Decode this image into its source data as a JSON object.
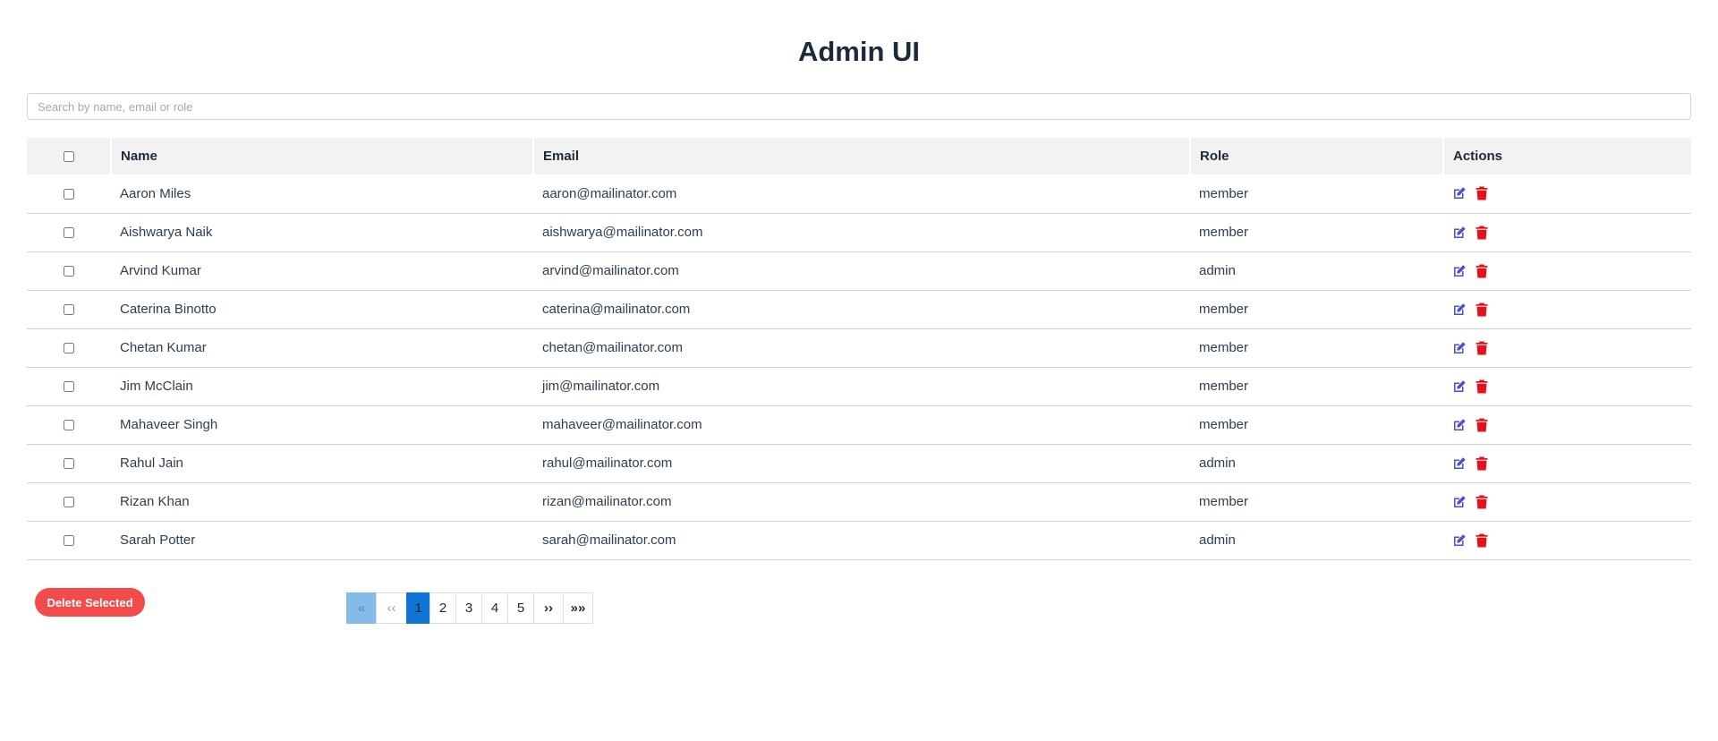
{
  "page": {
    "title": "Admin UI"
  },
  "search": {
    "placeholder": "Search by name, email or role",
    "value": ""
  },
  "table": {
    "headers": {
      "name": "Name",
      "email": "Email",
      "role": "Role",
      "actions": "Actions"
    },
    "rows": [
      {
        "name": "Aaron Miles",
        "email": "aaron@mailinator.com",
        "role": "member"
      },
      {
        "name": "Aishwarya Naik",
        "email": "aishwarya@mailinator.com",
        "role": "member"
      },
      {
        "name": "Arvind Kumar",
        "email": "arvind@mailinator.com",
        "role": "admin"
      },
      {
        "name": "Caterina Binotto",
        "email": "caterina@mailinator.com",
        "role": "member"
      },
      {
        "name": "Chetan Kumar",
        "email": "chetan@mailinator.com",
        "role": "member"
      },
      {
        "name": "Jim McClain",
        "email": "jim@mailinator.com",
        "role": "member"
      },
      {
        "name": "Mahaveer Singh",
        "email": "mahaveer@mailinator.com",
        "role": "member"
      },
      {
        "name": "Rahul Jain",
        "email": "rahul@mailinator.com",
        "role": "admin"
      },
      {
        "name": "Rizan Khan",
        "email": "rizan@mailinator.com",
        "role": "member"
      },
      {
        "name": "Sarah Potter",
        "email": "sarah@mailinator.com",
        "role": "admin"
      }
    ],
    "row_icons": {
      "edit": "edit-icon",
      "delete": "trash-icon"
    }
  },
  "footer": {
    "delete_selected_label": "Delete Selected"
  },
  "pagination": {
    "first_label": "«",
    "prev_label": "‹‹",
    "pages": [
      "1",
      "2",
      "3",
      "4",
      "5"
    ],
    "current_page": "1",
    "next_label": "››",
    "last_label": "»»"
  },
  "colors": {
    "edit_icon": "#4a4fd6",
    "delete_icon": "#e8101a",
    "delete_button": "#f24b4b",
    "active_page": "#0f75d2",
    "first_page_disabled": "#85bbe8"
  }
}
